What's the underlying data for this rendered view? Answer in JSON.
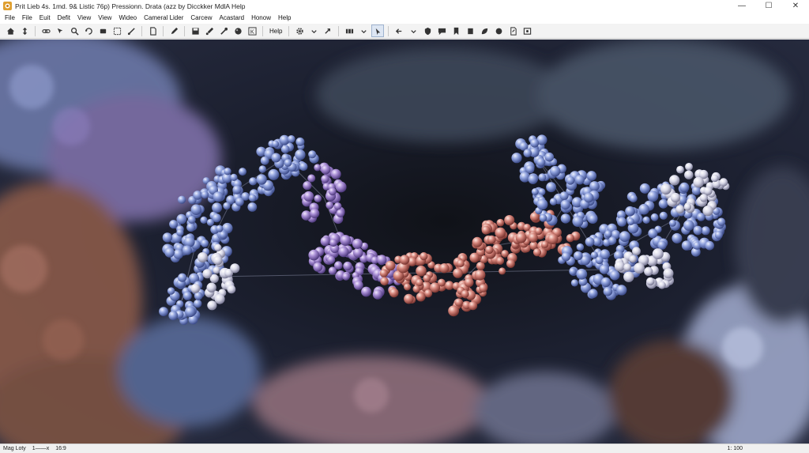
{
  "window": {
    "title": "Prit Lieb 4s. 1md. 9& Listic 76p) Pressionn. Drata (azz by Dicckker MdlA  Help",
    "minimize": "—",
    "maximize": "☐",
    "close": "✕"
  },
  "menu": {
    "items": [
      "File",
      "File",
      "Euit",
      "Defit",
      "View",
      "View",
      "Wideo",
      "Cameral Lider",
      "Carcew",
      "Acastard",
      "Honow",
      "Help"
    ]
  },
  "toolbar": {
    "help_label": "Help",
    "icons": [
      "home-icon",
      "move-icon",
      "link-icon",
      "pick-icon",
      "zoom-icon",
      "rotate-icon",
      "pan-icon",
      "select-icon",
      "measure-icon",
      "document-icon",
      "pen-icon",
      "save-icon",
      "brush-icon",
      "pipette-icon",
      "sphere-icon",
      "k-icon",
      "gear-icon",
      "arrow-icon",
      "grid-icon",
      "cursor-icon",
      "back-icon",
      "shield-icon",
      "chat-icon",
      "bookmark-icon",
      "square-icon",
      "leaf-icon",
      "circle-icon",
      "export-icon",
      "frame-icon"
    ]
  },
  "status": {
    "left_label": "Mag Loty",
    "scale": "1——x",
    "aspect": "16:9",
    "right": "1: 100"
  },
  "colors": {
    "titlebar": "#ffffff",
    "toolbar": "#f3f3f3",
    "molecule_blue": "#7f93d4",
    "molecule_purple": "#9a80c8",
    "molecule_red": "#c9736a",
    "background_brown": "#8a5a48"
  }
}
